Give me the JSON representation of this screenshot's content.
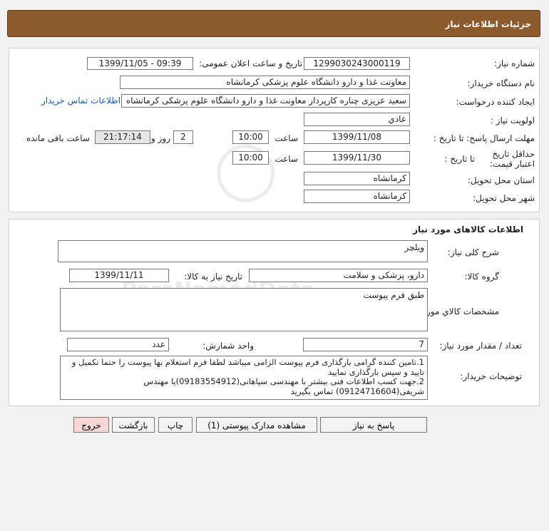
{
  "header": {
    "title": "جزئیات اطلاعات نیاز"
  },
  "info": {
    "need_number_label": "شماره نیاز:",
    "need_number_value": "1299030243000119",
    "announce_label": "تاریخ و ساعت اعلان عمومی:",
    "announce_value": "1399/11/05 - 09:39",
    "buyer_org_label": "نام دستگاه خریدار:",
    "buyer_org_value": "معاونت غذا و دارو دانشگاه علوم پزشکی کرمانشاه",
    "requester_label": "ایجاد کننده درخواست:",
    "requester_value": "سعید عزیزی چناره کارپرداز معاونت غذا و دارو دانشگاه علوم پزشکی کرمانشاه",
    "contact_link": "اطلاعات تماس خریدار",
    "priority_label": "اولویت نیاز :",
    "priority_value": "عادي",
    "deadline_label": "مهلت ارسال پاسخ: تا تاریخ :",
    "deadline_date": "1399/11/08",
    "hour_label": "ساعت",
    "deadline_time": "10:00",
    "days_value": "2",
    "days_label": "روز و",
    "remaining_time": "21:17:14",
    "remaining_label": "ساعت باقی مانده",
    "validity_label": "حداقل تاریخ اعتبار قیمت:",
    "validity_to_label": "تا تاریخ :",
    "validity_date": "1399/11/30",
    "validity_hour_label": "ساعت",
    "validity_time": "10:00",
    "province_label": "استان محل تحویل:",
    "province_value": "کرمانشاه",
    "city_label": "شهر محل تحویل:",
    "city_value": "کرمانشاه"
  },
  "goods": {
    "section_title": "اطلاعات کالاهای مورد نیاز",
    "summary_label": "شرح کلی نیاز:",
    "summary_value": "ویلچر",
    "group_label": "گروه کالا:",
    "group_value": "دارو، پزشکی و سلامت",
    "need_date_label": "تاریخ نیاز به کالا:",
    "need_date_value": "1399/11/11",
    "specs_label": "مشخصات کالاي مورد نیاز:",
    "specs_value": "طبق فرم پیوست",
    "qty_label": "تعداد / مقدار مورد نیاز:",
    "qty_value": "7",
    "unit_label": "واحد شمارش:",
    "unit_value": "عدد",
    "desc_label": "توضیحات خریدار:",
    "desc_line1": "1.تامین کننده گرامی  بارگذاری فرم پیوست الزامی میباشد لطفا فرم استعلام بها پیوست را حتما تکمیل و تایید و سپس بارگذاری نمایید",
    "desc_line2": "2.جهت کسب اطلاعات فنی بیشتر با مهندسی سپاهانی(09183554912)یا مهندس شریفی(09124716604) تماس بگیرید"
  },
  "buttons": {
    "reply": "پاسخ به نیاز",
    "attachments": "مشاهده مدارک پیوستی (1)",
    "print": "چاپ",
    "back": "بازگشت",
    "exit": "خروج"
  }
}
